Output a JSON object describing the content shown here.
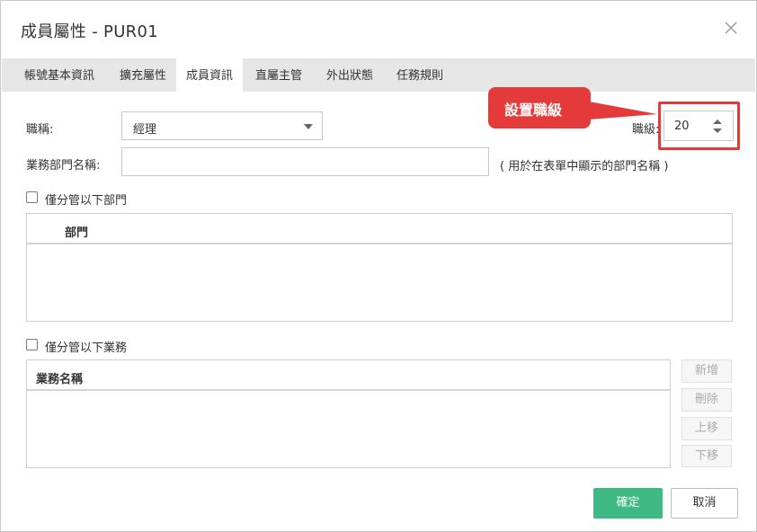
{
  "dialog": {
    "title": "成員屬性 - PUR01"
  },
  "tabs": [
    {
      "label": "帳號基本資訊"
    },
    {
      "label": "擴充屬性"
    },
    {
      "label": "成員資訊"
    },
    {
      "label": "直屬主管"
    },
    {
      "label": "外出狀態"
    },
    {
      "label": "任務規則"
    }
  ],
  "active_tab": "成員資訊",
  "form": {
    "title_label": "職稱:",
    "title_value": "經理",
    "dept_name_label": "業務部門名稱:",
    "dept_name_value": "",
    "dept_name_hint": "( 用於在表單中顯示的部門名稱 )",
    "level_label": "職級:",
    "level_value": "20"
  },
  "callout": {
    "text": "設置職級",
    "color": "#e53a3a"
  },
  "dept_section": {
    "checkbox_label": "僅分管以下部門",
    "column_header": "部門"
  },
  "business_section": {
    "checkbox_label": "僅分管以下業務",
    "column_header": "業務名稱",
    "buttons": {
      "add": "新增",
      "delete": "刪除",
      "move_up": "上移",
      "move_down": "下移"
    }
  },
  "footer": {
    "ok_label": "確定",
    "cancel_label": "取消",
    "ok_color": "#3fb983"
  },
  "icons": {
    "close": "close-icon",
    "dropdown": "chevron-down-icon",
    "spinner": "spinner-arrows-icon"
  }
}
